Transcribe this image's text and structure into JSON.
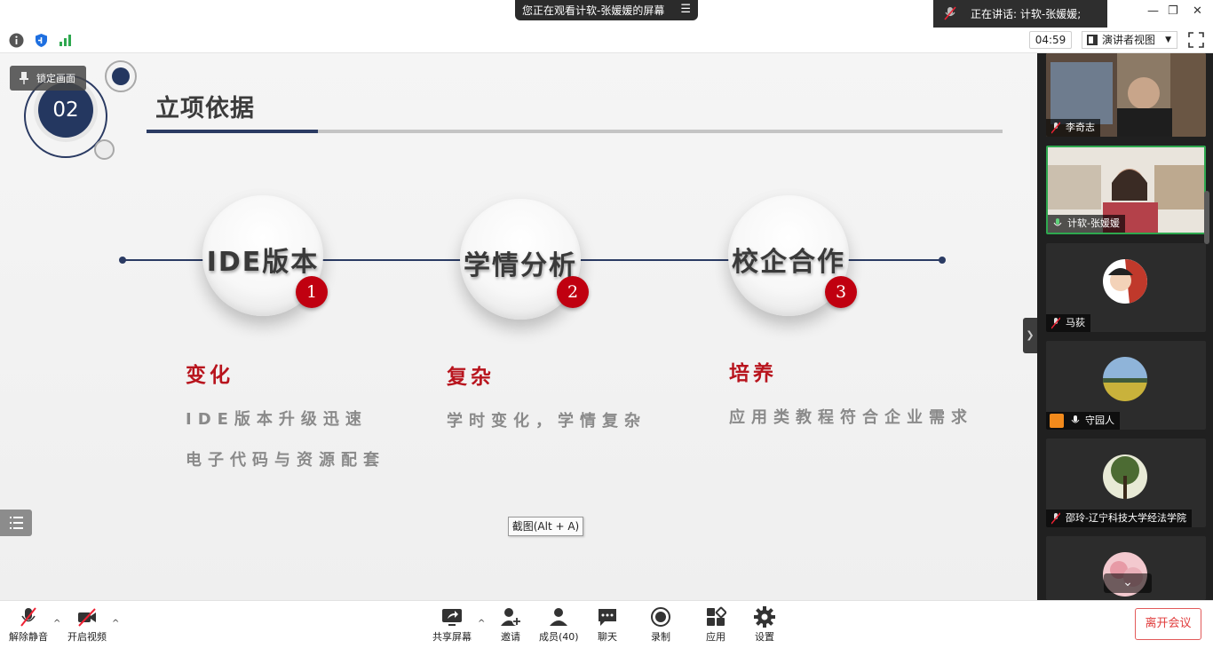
{
  "top": {
    "share_banner": "您正在观看计软-张媛媛的屏幕",
    "speaker": "正在讲话: 计软-张媛媛;",
    "timer": "04:59",
    "view_mode": "演讲者视图"
  },
  "slide": {
    "lock_label": "锁定画面",
    "section_number": "02",
    "title": "立项依据",
    "items": [
      {
        "bubble": "IDE版本",
        "badge": "1",
        "head": "变化",
        "lines": [
          "IDE版本升级迅速",
          "电子代码与资源配套"
        ]
      },
      {
        "bubble": "学情分析",
        "badge": "2",
        "head": "复杂",
        "lines": [
          "学时变化，学情复杂"
        ]
      },
      {
        "bubble": "校企合作",
        "badge": "3",
        "head": "培养",
        "lines": [
          "应用类教程符合企业需求"
        ]
      }
    ],
    "tooltip": "截图(Alt + A)"
  },
  "participants": [
    {
      "name": "李奇志"
    },
    {
      "name": "计软-张媛媛"
    },
    {
      "name": "马荻"
    },
    {
      "name": "守园人"
    },
    {
      "name": "邵玲-辽宁科技大学经法学院"
    }
  ],
  "bottom": {
    "unmute": "解除静音",
    "video": "开启视频",
    "share": "共享屏幕",
    "invite": "邀请",
    "members": "成员(40)",
    "chat": "聊天",
    "record": "录制",
    "apps": "应用",
    "settings": "设置",
    "leave": "离开会议"
  },
  "colors": {
    "navy": "#243760",
    "red": "#c00010",
    "leave": "#e03c3c",
    "active": "#2ea84f"
  }
}
